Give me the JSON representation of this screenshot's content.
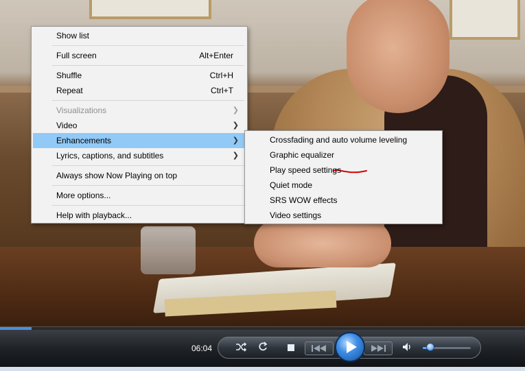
{
  "menu": {
    "items": [
      {
        "label": "Show list",
        "shortcut": "",
        "submenu": false,
        "disabled": false
      },
      {
        "label": "Full screen",
        "shortcut": "Alt+Enter",
        "submenu": false,
        "disabled": false
      },
      {
        "label": "Shuffle",
        "shortcut": "Ctrl+H",
        "submenu": false,
        "disabled": false
      },
      {
        "label": "Repeat",
        "shortcut": "Ctrl+T",
        "submenu": false,
        "disabled": false
      },
      {
        "label": "Visualizations",
        "shortcut": "",
        "submenu": true,
        "disabled": true
      },
      {
        "label": "Video",
        "shortcut": "",
        "submenu": true,
        "disabled": false
      },
      {
        "label": "Enhancements",
        "shortcut": "",
        "submenu": true,
        "disabled": false,
        "highlighted": true
      },
      {
        "label": "Lyrics, captions, and subtitles",
        "shortcut": "",
        "submenu": true,
        "disabled": false
      },
      {
        "label": "Always show Now Playing on top",
        "shortcut": "",
        "submenu": false,
        "disabled": false
      },
      {
        "label": "More options...",
        "shortcut": "",
        "submenu": false,
        "disabled": false
      },
      {
        "label": "Help with playback...",
        "shortcut": "",
        "submenu": false,
        "disabled": false
      }
    ]
  },
  "submenu": {
    "items": [
      {
        "label": "Crossfading and auto volume leveling"
      },
      {
        "label": "Graphic equalizer",
        "annotated": true
      },
      {
        "label": "Play speed settings"
      },
      {
        "label": "Quiet mode"
      },
      {
        "label": "SRS WOW effects"
      },
      {
        "label": "Video settings"
      }
    ]
  },
  "player": {
    "time": "06:04",
    "seek_progress": 0.06,
    "volume_level": 0.15,
    "accent_color": "#3f8ee6",
    "annotation_color": "#d40000"
  },
  "icons": [
    "shuffle-icon",
    "repeat-icon",
    "stop-icon",
    "previous-icon",
    "play-icon",
    "next-icon",
    "speaker-icon",
    "chevron-right-icon"
  ]
}
